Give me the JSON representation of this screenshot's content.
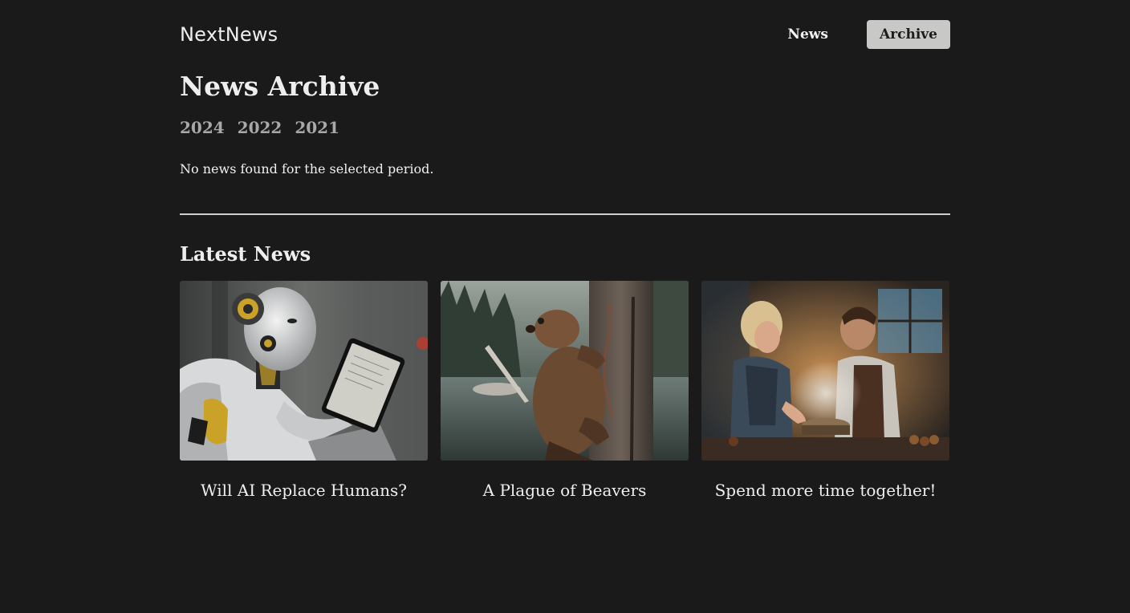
{
  "header": {
    "logo": "NextNews",
    "nav": [
      {
        "label": "News",
        "active": false
      },
      {
        "label": "Archive",
        "active": true
      }
    ]
  },
  "archive": {
    "title": "News Archive",
    "years": [
      "2024",
      "2022",
      "2021"
    ],
    "empty_message": "No news found for the selected period."
  },
  "latest": {
    "title": "Latest News",
    "cards": [
      {
        "title": "Will AI Replace Humans?",
        "image": "robot-reading-tablet"
      },
      {
        "title": "A Plague of Beavers",
        "image": "beaver-on-tree-by-lake"
      },
      {
        "title": "Spend more time together!",
        "image": "couple-cooking-in-kitchen"
      }
    ]
  },
  "colors": {
    "background": "#1a1a1a",
    "active_nav_bg": "#c8c8c6",
    "year_link": "#a8a8a8"
  }
}
